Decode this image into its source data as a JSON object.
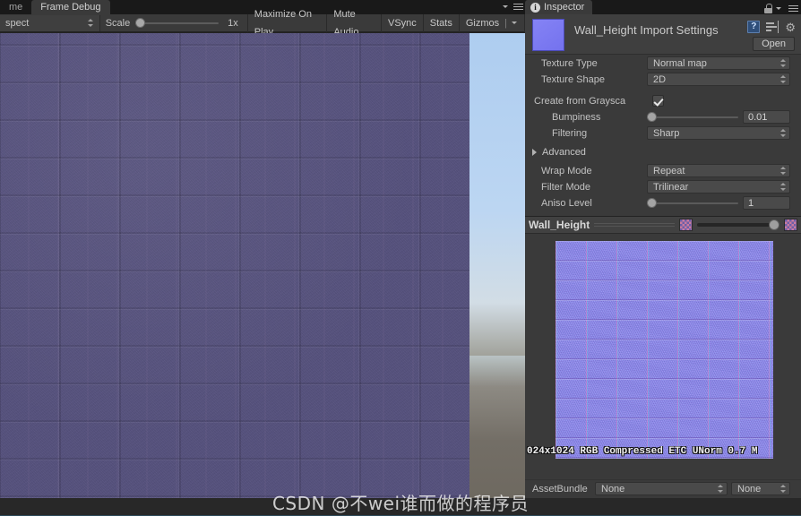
{
  "game_panel": {
    "tabs": [
      {
        "label": "me",
        "icon": "game-tab",
        "active": false
      },
      {
        "label": "Frame Debug",
        "icon": "frame-debug-tab",
        "active": true
      }
    ],
    "tab_menu_icon": "hamburger-menu-icon",
    "toolbar": {
      "aspect_label": "spect",
      "scale_label": "Scale",
      "scale_value": "1x",
      "buttons": [
        "Maximize On Play",
        "Mute Audio",
        "VSync",
        "Stats",
        "Gizmos"
      ],
      "gizmos_dropdown_icon": "chevron-down-icon"
    }
  },
  "inspector": {
    "tab": {
      "label": "Inspector",
      "icon": "info-icon",
      "lock_icon": "lock-icon",
      "menu_icon": "hamburger-menu-icon"
    },
    "header": {
      "title": "Wall_Height Import Settings",
      "thumbnail_color": "#7b79f2",
      "open_label": "Open",
      "icons": [
        "help-book-icon",
        "preset-icon",
        "gear-icon"
      ]
    },
    "settings": [
      {
        "name": "texture-type",
        "label": "Texture Type",
        "control": "dropdown",
        "value": "Normal map"
      },
      {
        "name": "texture-shape",
        "label": "Texture Shape",
        "control": "dropdown",
        "value": "2D"
      },
      {
        "name": "create-from-grayscale",
        "label": "Create from Graysca",
        "control": "checkbox",
        "value": "checked"
      },
      {
        "name": "bumpiness",
        "label": "Bumpiness",
        "control": "slider",
        "value": "0.01",
        "slider_pct": 2
      },
      {
        "name": "filtering",
        "label": "Filtering",
        "control": "dropdown",
        "value": "Sharp"
      }
    ],
    "advanced_foldout": {
      "label": "Advanced",
      "icon": "triangle-right-icon",
      "expanded": false
    },
    "settings2": [
      {
        "name": "wrap-mode",
        "label": "Wrap Mode",
        "control": "dropdown",
        "value": "Repeat"
      },
      {
        "name": "filter-mode",
        "label": "Filter Mode",
        "control": "dropdown",
        "value": "Trilinear"
      },
      {
        "name": "aniso-level",
        "label": "Aniso Level",
        "control": "slider",
        "value": "1",
        "slider_pct": 5
      }
    ],
    "preview": {
      "title": "Wall_Height",
      "checker_icon": "checkerboard-icon",
      "alpha_icon": "alpha-checkerboard-icon",
      "mip_slider_pct": 100,
      "caption": "024x1024  RGB Compressed ETC UNorm   0.7 M"
    },
    "assetbundle": {
      "label": "AssetBundle",
      "name_value": "None",
      "variant_value": "None",
      "dropdown_icon": "updown-arrows-icon"
    }
  },
  "watermark": {
    "text": "CSDN @不wei谁而做的程序员"
  },
  "colors": {
    "panel_bg": "#3a3a3a",
    "tabbar_bg": "#191919",
    "field_bg": "#4a4a4a",
    "text": "#c2c2c2",
    "accent_thumb": "#7b79f2",
    "sky": "#aecdf0",
    "wall": "#56527e",
    "normal_map": "#8683f0"
  }
}
